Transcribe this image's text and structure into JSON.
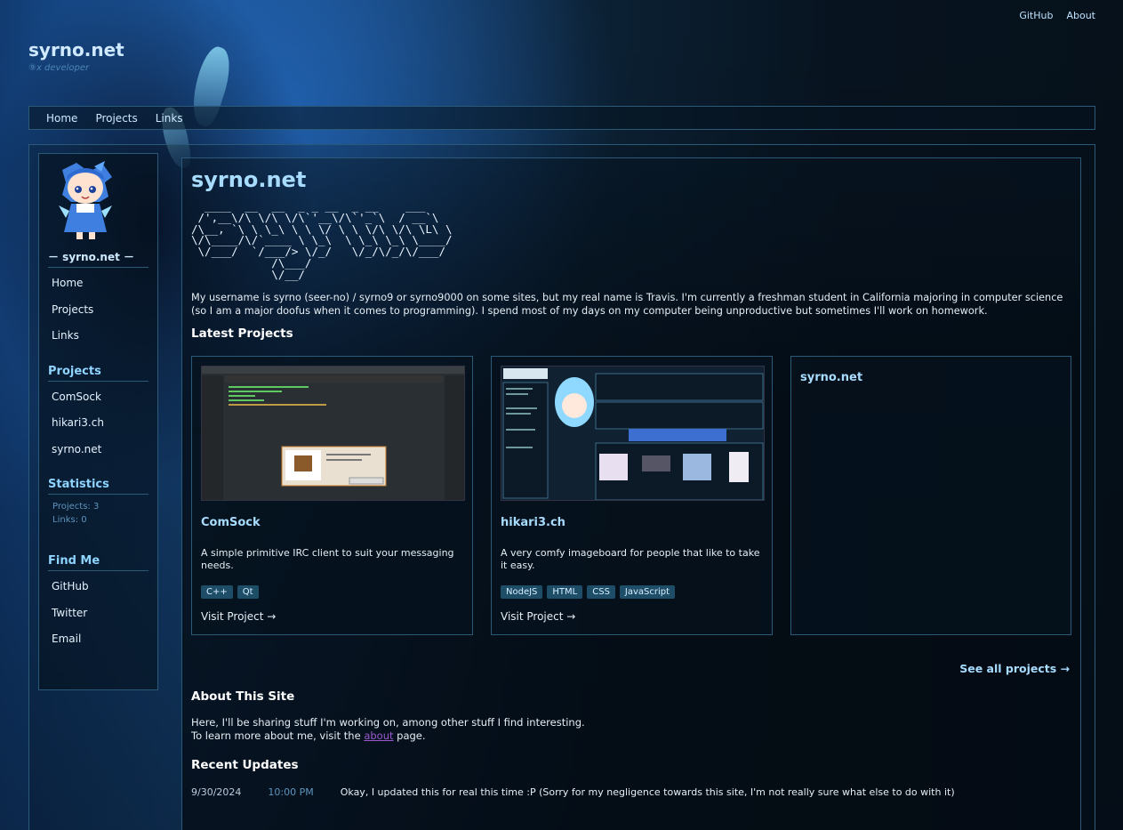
{
  "topnav": {
    "github": "GitHub",
    "about": "About"
  },
  "brand": {
    "title": "syrno.net",
    "subtitle": "⑨x developer"
  },
  "mainnav": {
    "items": [
      "Home",
      "Projects",
      "Links"
    ]
  },
  "sidebar": {
    "brand": "－ syrno.net －",
    "nav": [
      "Home",
      "Projects",
      "Links"
    ],
    "projects_heading": "Projects",
    "projects": [
      "ComSock",
      "hikari3.ch",
      "syrno.net"
    ],
    "stats_heading": "Statistics",
    "stats": {
      "projects": "Projects: 3",
      "links": "Links: 0"
    },
    "findme_heading": "Find Me",
    "findme": [
      "GitHub",
      "Twitter",
      "Email"
    ]
  },
  "content": {
    "title": "syrno.net",
    "ascii": "  ____  __  __  _ _ __  _ __    ___  \n /',__\\/\\ \\/\\ \\/\\`'__\\/\\`'_`\\  / __`\\\n/\\__, `\\ \\ \\_\\ \\ \\ \\/ \\ \\ \\/\\ \\/\\ \\L\\ \\\n\\/\\____/\\/`____ \\ \\_\\  \\ \\_\\ \\_\\ \\____/\n \\/___/  `/___/> \\/_/   \\/_/\\/_/\\/___/ \n            /\\___/                    \n            \\/__/                     ",
    "intro": "My username is syrno (seer-no) / syrno9 or syrno9000 on some sites, but my real name is Travis. I'm currently a freshman student in California majoring in computer science (so I am a major doofus when it comes to programming). I spend most of my days on my computer being unproductive but sometimes I'll work on homework.",
    "latest_heading": "Latest Projects",
    "cards": [
      {
        "title": "ComSock",
        "desc": "A simple primitive IRC client to suit your messaging needs.",
        "tags": [
          "C++",
          "Qt"
        ],
        "visit": "Visit Project →"
      },
      {
        "title": "hikari3.ch",
        "desc": "A very comfy imageboard for people that like to take it easy.",
        "tags": [
          "NodeJS",
          "HTML",
          "CSS",
          "JavaScript"
        ],
        "visit": "Visit Project →"
      },
      {
        "title": "syrno.net"
      }
    ],
    "see_all": "See all projects →",
    "about_heading": "About This Site",
    "about_line1": "Here, I'll be sharing stuff I'm working on, among other stuff I find interesting.",
    "about_line2_pre": "To learn more about me, visit the ",
    "about_link": "about",
    "about_line2_post": " page.",
    "updates_heading": "Recent Updates",
    "updates": [
      {
        "date": "9/30/2024",
        "time": "10:00 PM",
        "text": "Okay, I updated this for real this time :P (Sorry for my negligence towards this site, I'm not really sure what else to do with it)"
      }
    ]
  },
  "colors": {
    "accent": "#a8dcff",
    "border": "#2a5a78",
    "tag_bg": "#1e4d68",
    "link_visited": "#9b59d0"
  }
}
